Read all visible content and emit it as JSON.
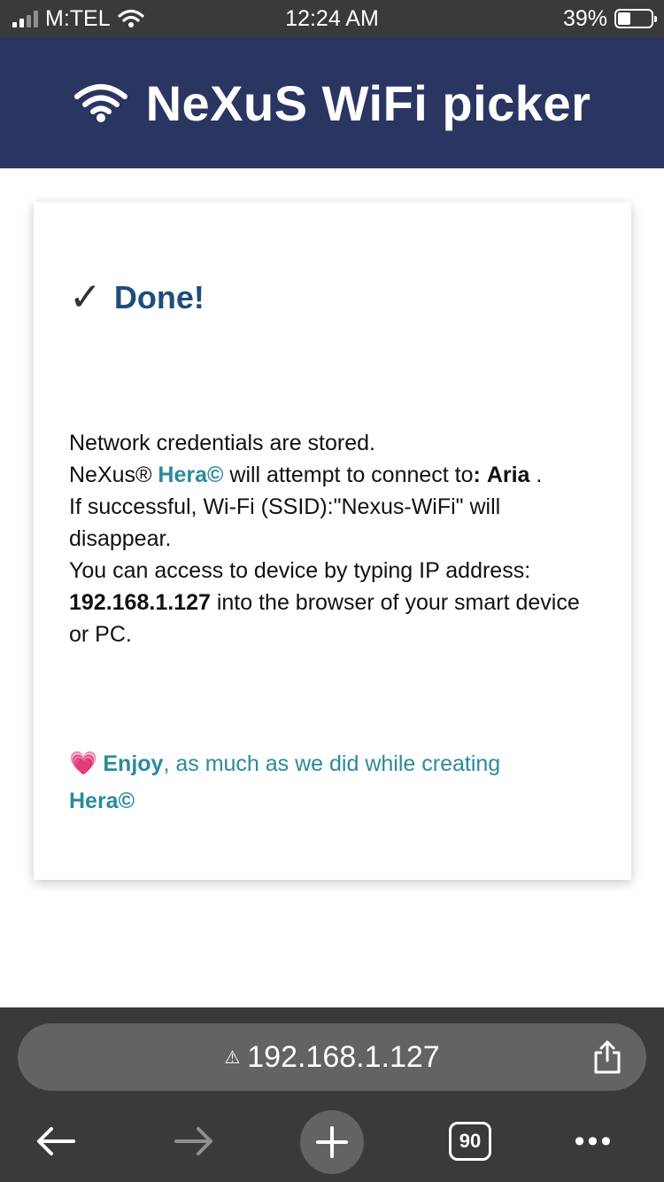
{
  "status_bar": {
    "carrier": "M:TEL",
    "time": "12:24 AM",
    "battery": "39%",
    "battery_level": 0.39,
    "signal_bars": 2,
    "icons": [
      "signal-icon",
      "wifi-icon",
      "battery-icon"
    ]
  },
  "header": {
    "title": "NeXuS WiFi picker",
    "icon": "wifi-icon",
    "background": "#2b3562"
  },
  "card": {
    "done_check": "✓",
    "done_title": "Done!",
    "message": {
      "line1": "Network credentials are stored.",
      "brand": "NeXus®",
      "product": "Hera©",
      "connect_text": "will attempt to connect to",
      "connect_colon": ":",
      "network": "Aria",
      "period": ".",
      "ssid_text": "If successful, Wi-Fi (SSID):\"Nexus-WiFi\" will disappear.",
      "access_text": "You can access to device by typing IP address:",
      "ip": "192.168.1.127",
      "access_tail": "into the browser of your smart device or PC."
    },
    "enjoy": {
      "heart": "💗",
      "bold": "Enjoy",
      "rest": ", as much as we did while creating",
      "product": "Hera©"
    },
    "accent_color": "#2a8a9c",
    "title_color": "#1f4d7a"
  },
  "browser": {
    "url": "192.168.1.127",
    "warning_glyph": "⚠",
    "tab_count": "90",
    "more_glyph": "•••",
    "icons": [
      "warning-icon",
      "share-icon",
      "back-arrow-icon",
      "forward-arrow-icon",
      "plus-icon",
      "tabs-icon",
      "more-icon"
    ]
  }
}
